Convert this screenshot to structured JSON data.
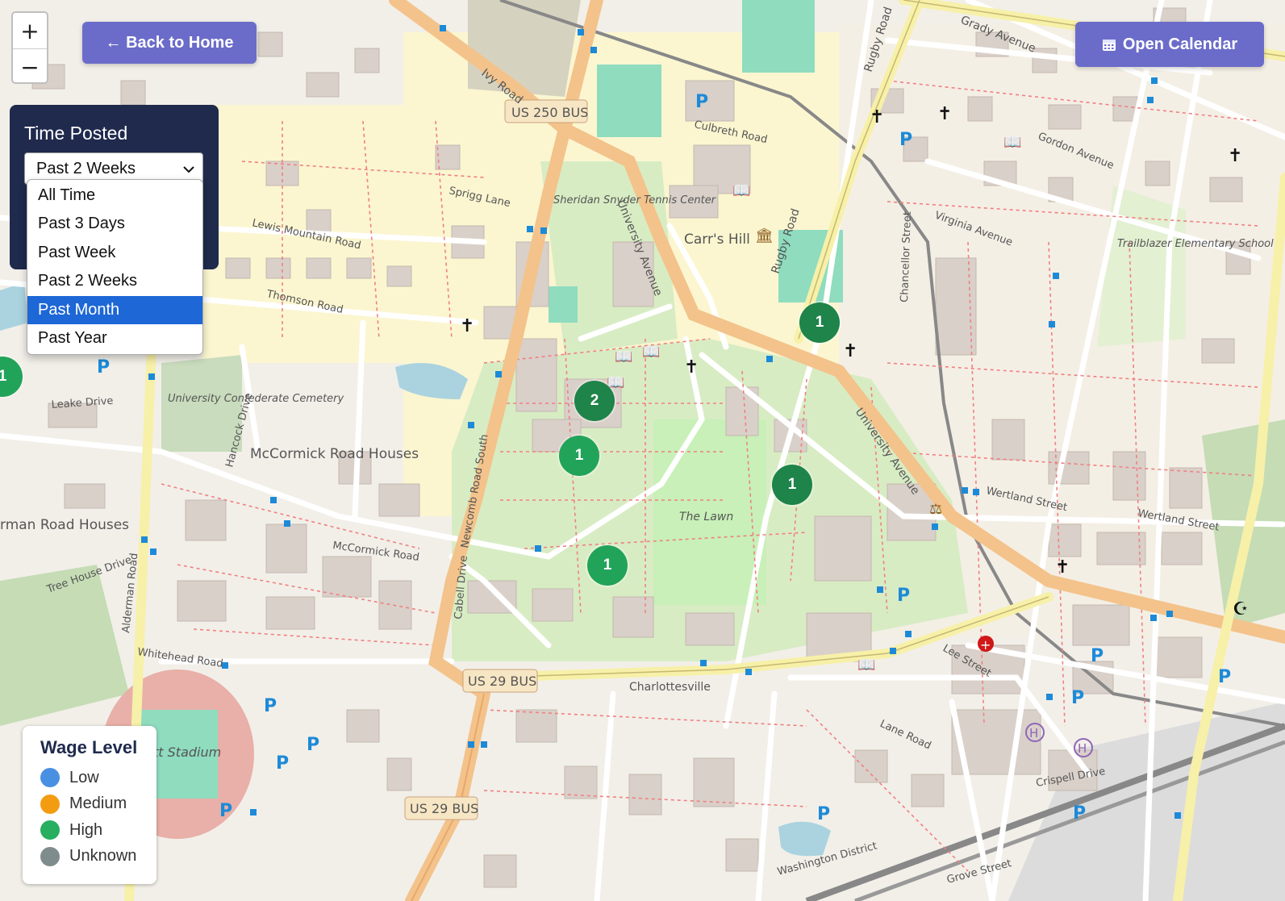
{
  "zoom": {
    "in_label": "+",
    "out_label": "−"
  },
  "nav": {
    "back_label": "← Back to Home",
    "calendar_label": "Open Calendar",
    "calendar_icon": "calendar-icon"
  },
  "filter": {
    "title": "Time Posted",
    "selected": "Past 2 Weeks",
    "options": [
      "All Time",
      "Past 3 Days",
      "Past Week",
      "Past 2 Weeks",
      "Past Month",
      "Past Year"
    ],
    "highlighted_option": "Past Month"
  },
  "legend": {
    "title": "Wage Level",
    "items": [
      {
        "label": "Low",
        "color": "#4a90e2"
      },
      {
        "label": "Medium",
        "color": "#f39c12"
      },
      {
        "label": "High",
        "color": "#27ae60"
      },
      {
        "label": "Unknown",
        "color": "#7f8c8d"
      }
    ]
  },
  "markers": [
    {
      "count": "1"
    },
    {
      "count": "1"
    },
    {
      "count": "2"
    },
    {
      "count": "1"
    },
    {
      "count": "1"
    },
    {
      "count": "1"
    }
  ],
  "map_labels": {
    "ivy_road": "Ivy Road",
    "us250": "US 250 BUS",
    "us29a": "US 29 BUS",
    "us29b": "US 29 BUS",
    "grady": "Grady Avenue",
    "rugby": "Rugby Road",
    "rugby2": "Rugby Road",
    "univ_ave": "University Avenue",
    "univ_ave2": "University Avenue",
    "carrs_hill": "Carr's Hill",
    "lawn": "The Lawn",
    "mccormick": "McCormick Road",
    "mccormick_houses": "McCormick Road Houses",
    "cemetery": "University Confederate Cemetery",
    "sheridan": "Sheridan Snyder Tennis Center",
    "charlottesville": "Charlottesville",
    "stadium": "tt Stadium",
    "wertland": "Wertland Street",
    "wertland2": "Wertland Street",
    "trailblazer": "Trailblazer Elementary School",
    "culbreth": "Culbreth Road",
    "thomson": "Thomson Road",
    "lewis": "Lewis Mountain Road",
    "sprigg": "Sprigg Lane",
    "newcomb": "Newcomb Road South",
    "alderman": "Alderman Road",
    "cabell": "Cabell Drive",
    "crispell": "Crispell Drive",
    "lee": "Lee Street",
    "lane": "Lane Road",
    "washington": "Washington District",
    "grove": "Grove Street",
    "whitehead": "Whitehead Road",
    "leake": "Leake Drive",
    "hancock": "Hancock Drive",
    "emmet": "rman Road Houses",
    "tree_house": "Tree House Drive",
    "virginia": "Virginia Avenue",
    "gordon": "Gordon Avenue",
    "chancellor": "Chancellor Street"
  }
}
